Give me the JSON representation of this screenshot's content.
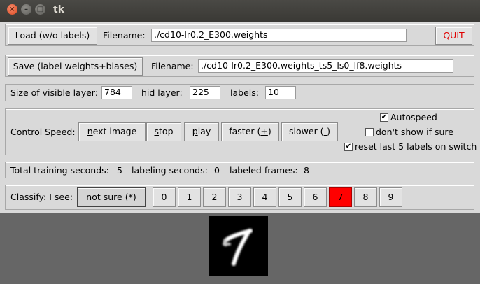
{
  "window": {
    "title": "tk",
    "close_glyph": "×",
    "min_glyph": "–",
    "max_glyph": "□"
  },
  "load_row": {
    "load_button": "Load (w/o labels)",
    "filename_label": "Filename:",
    "filename_value": "./cd10-lr0.2_E300.weights",
    "quit_button": "QUIT"
  },
  "save_row": {
    "save_button": "Save (label weights+biases)",
    "filename_label": "Filename:",
    "filename_value": "./cd10-lr0.2_E300.weights_ts5_ls0_lf8.weights"
  },
  "layers_row": {
    "visible_label": "Size of visible layer:",
    "visible_value": "784",
    "hid_label": "hid layer:",
    "hid_value": "225",
    "labels_label": "labels:",
    "labels_value": "10"
  },
  "speed_row": {
    "label": "Control Speed:",
    "next_prefix": "n",
    "next_rest": "ext image",
    "stop_prefix": "s",
    "stop_rest": "top",
    "play_prefix": "p",
    "play_rest": "lay",
    "faster_text": "faster (",
    "faster_key": "+",
    "faster_end": ")",
    "slower_text": "slower (",
    "slower_key": "-",
    "slower_end": ")",
    "autospeed_label": "Autospeed",
    "autospeed_checked": true,
    "dont_show_label": "don't show if sure",
    "dont_show_checked": false,
    "reset_label": "reset last 5 labels on switch",
    "reset_checked": true
  },
  "stats_row": {
    "training_label": "Total training seconds:",
    "training_value": "5",
    "labeling_label": "labeling seconds:",
    "labeling_value": "0",
    "frames_label": "labeled frames:",
    "frames_value": "8"
  },
  "classify_row": {
    "label": "Classify: I see:",
    "not_sure_text": "not sure (",
    "not_sure_key": "*",
    "not_sure_end": ")",
    "digits": [
      "0",
      "1",
      "2",
      "3",
      "4",
      "5",
      "6",
      "7",
      "8",
      "9"
    ],
    "selected_digit": "7",
    "selected_color": "#ff0000"
  },
  "image": {
    "depicted_digit": "7"
  }
}
